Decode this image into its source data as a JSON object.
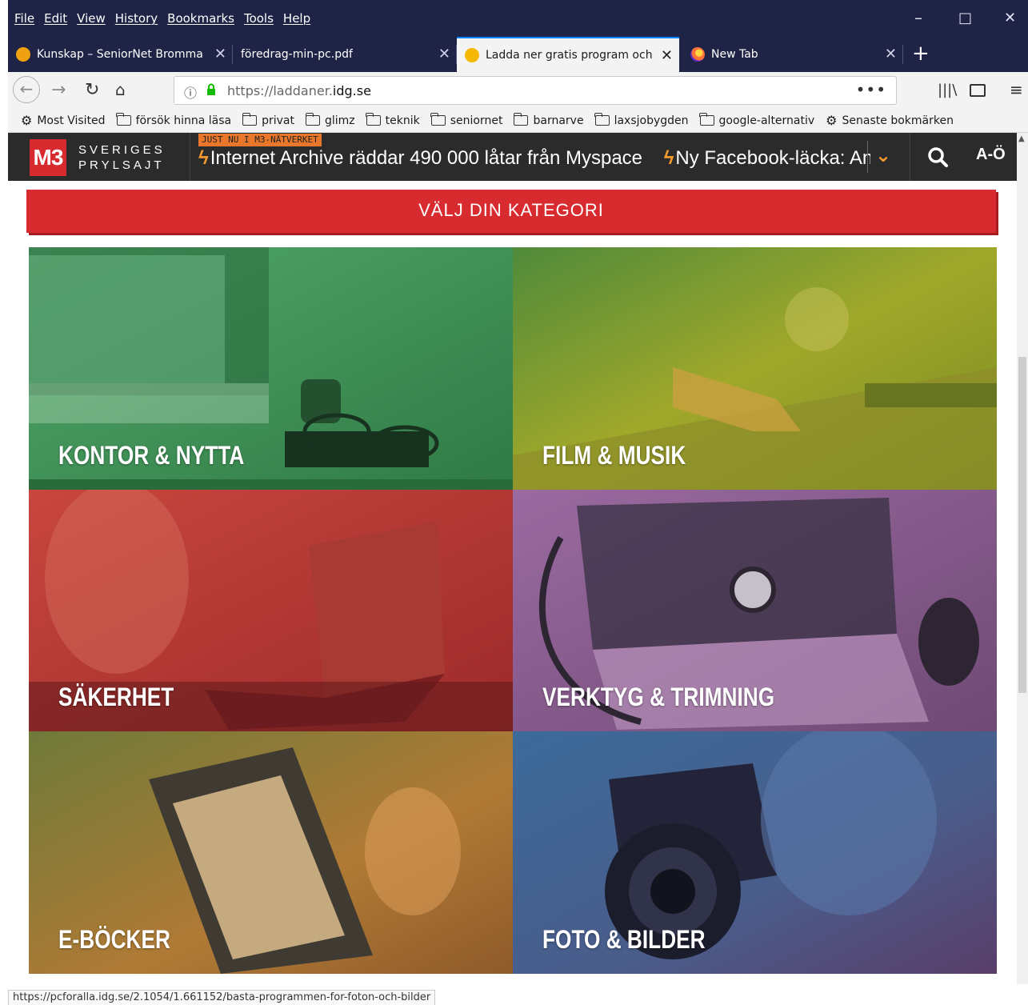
{
  "menu": {
    "items": [
      "File",
      "Edit",
      "View",
      "History",
      "Bookmarks",
      "Tools",
      "Help"
    ]
  },
  "window_controls": {
    "minimize": "–",
    "maximize": "□",
    "close": "✕"
  },
  "tabs": [
    {
      "label": "Kunskap – SeniorNet Bromma",
      "icon": "seniornet-icon",
      "active": false
    },
    {
      "label": "föredrag-min-pc.pdf",
      "icon": "pdf-icon",
      "active": false
    },
    {
      "label": "Ladda ner gratis program och e",
      "icon": "idg-icon",
      "active": true
    },
    {
      "label": "New Tab",
      "icon": "firefox-icon",
      "active": false
    }
  ],
  "navbar": {
    "url_prefix": "https://laddaner.",
    "url_domain": "idg.se",
    "page_actions": "•••"
  },
  "bookmarks": [
    {
      "label": "Most Visited",
      "type": "gear"
    },
    {
      "label": "försök hinna läsa",
      "type": "folder"
    },
    {
      "label": "privat",
      "type": "folder"
    },
    {
      "label": "glimz",
      "type": "folder"
    },
    {
      "label": "teknik",
      "type": "folder"
    },
    {
      "label": "seniornet",
      "type": "folder"
    },
    {
      "label": "barnarve",
      "type": "folder"
    },
    {
      "label": "laxsjobygden",
      "type": "folder"
    },
    {
      "label": "google-alternativ",
      "type": "folder"
    },
    {
      "label": "Senaste bokmärken",
      "type": "gear"
    }
  ],
  "site": {
    "logo": "M3",
    "slogan_line1": "SVERIGES",
    "slogan_line2": "PRYLSAJT",
    "just_nu": "JUST NU I M3-NÄTVERKET",
    "ticker": [
      "Internet Archive räddar 490 000 låtar från Myspace",
      "Ny Facebook-läcka: Användaruppgifter"
    ],
    "ao": "A-Ö",
    "category_button": "VÄLJ DIN KATEGORI",
    "categories": [
      {
        "label": "KONTOR & NYTTA",
        "color": "#3f9a5a"
      },
      {
        "label": "FILM & MUSIK",
        "color": "#8ea52c"
      },
      {
        "label": "SÄKERHET",
        "color": "#c4393a"
      },
      {
        "label": "VERKTYG & TRIMNING",
        "color": "#8e5a8c"
      },
      {
        "label": "E-BÖCKER",
        "color": "#a4702f"
      },
      {
        "label": "FOTO & BILDER",
        "color": "#3f5f94"
      }
    ]
  },
  "status_url": "https://pcforalla.idg.se/2.1054/1.661152/basta-programmen-for-foton-och-bilder"
}
